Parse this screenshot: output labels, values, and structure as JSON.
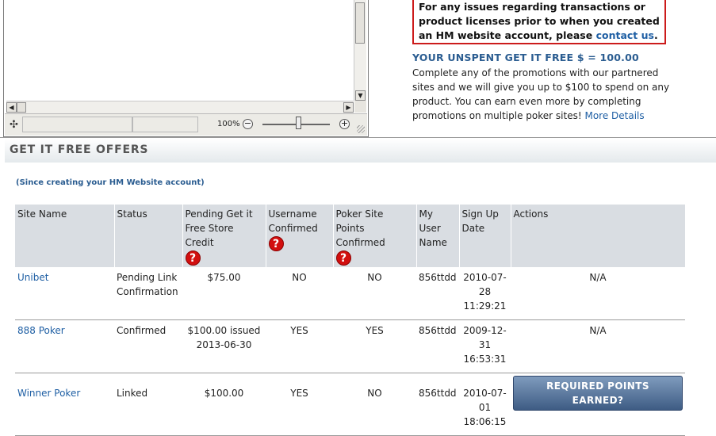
{
  "viewer": {
    "zoom": "100%",
    "zoom_out_symbol": "−",
    "zoom_in_symbol": "+",
    "move_icon": "✣"
  },
  "notice": {
    "text": "For any issues regarding transactions or product licenses prior to when you created an HM website account, please",
    "link": "contact us",
    "end": "."
  },
  "unspent": {
    "title": "YOUR UNSPENT GET IT FREE $ = 100.00",
    "body": "Complete any of the promotions with our partnered sites and we will give you up to $100 to spend on any product. You can earn even more by completing promotions on multiple poker sites!",
    "more_link": "More Details"
  },
  "offers": {
    "title": "GET IT FREE OFFERS",
    "since": "(Since creating your HM Website account)",
    "columns": {
      "site": "Site Name",
      "status": "Status",
      "pending": "Pending Get it Free Store Credit",
      "username": "Username Confirmed",
      "points": "Poker Site Points Confirmed",
      "user": "My User Name",
      "signup": "Sign Up Date",
      "actions": "Actions"
    },
    "help_symbol": "?",
    "rows": [
      {
        "site": "Unibet",
        "status": "Pending Link Confirmation",
        "credit": "$75.00",
        "username": "NO",
        "points": "NO",
        "user": "856ttdd",
        "date": "2010-07-28 11:29:21",
        "action": "N/A"
      },
      {
        "site": "888 Poker",
        "status": "Confirmed",
        "credit": "$100.00 issued 2013-06-30",
        "username": "YES",
        "points": "YES",
        "user": "856ttdd",
        "date": "2009-12-31 16:53:31",
        "action": "N/A"
      },
      {
        "site": "Winner Poker",
        "status": "Linked",
        "credit": "$100.00",
        "username": "YES",
        "points": "NO",
        "user": "856ttdd",
        "date": "2010-07-01 18:06:15",
        "action": "REQUIRED POINTS EARNED?"
      }
    ]
  }
}
